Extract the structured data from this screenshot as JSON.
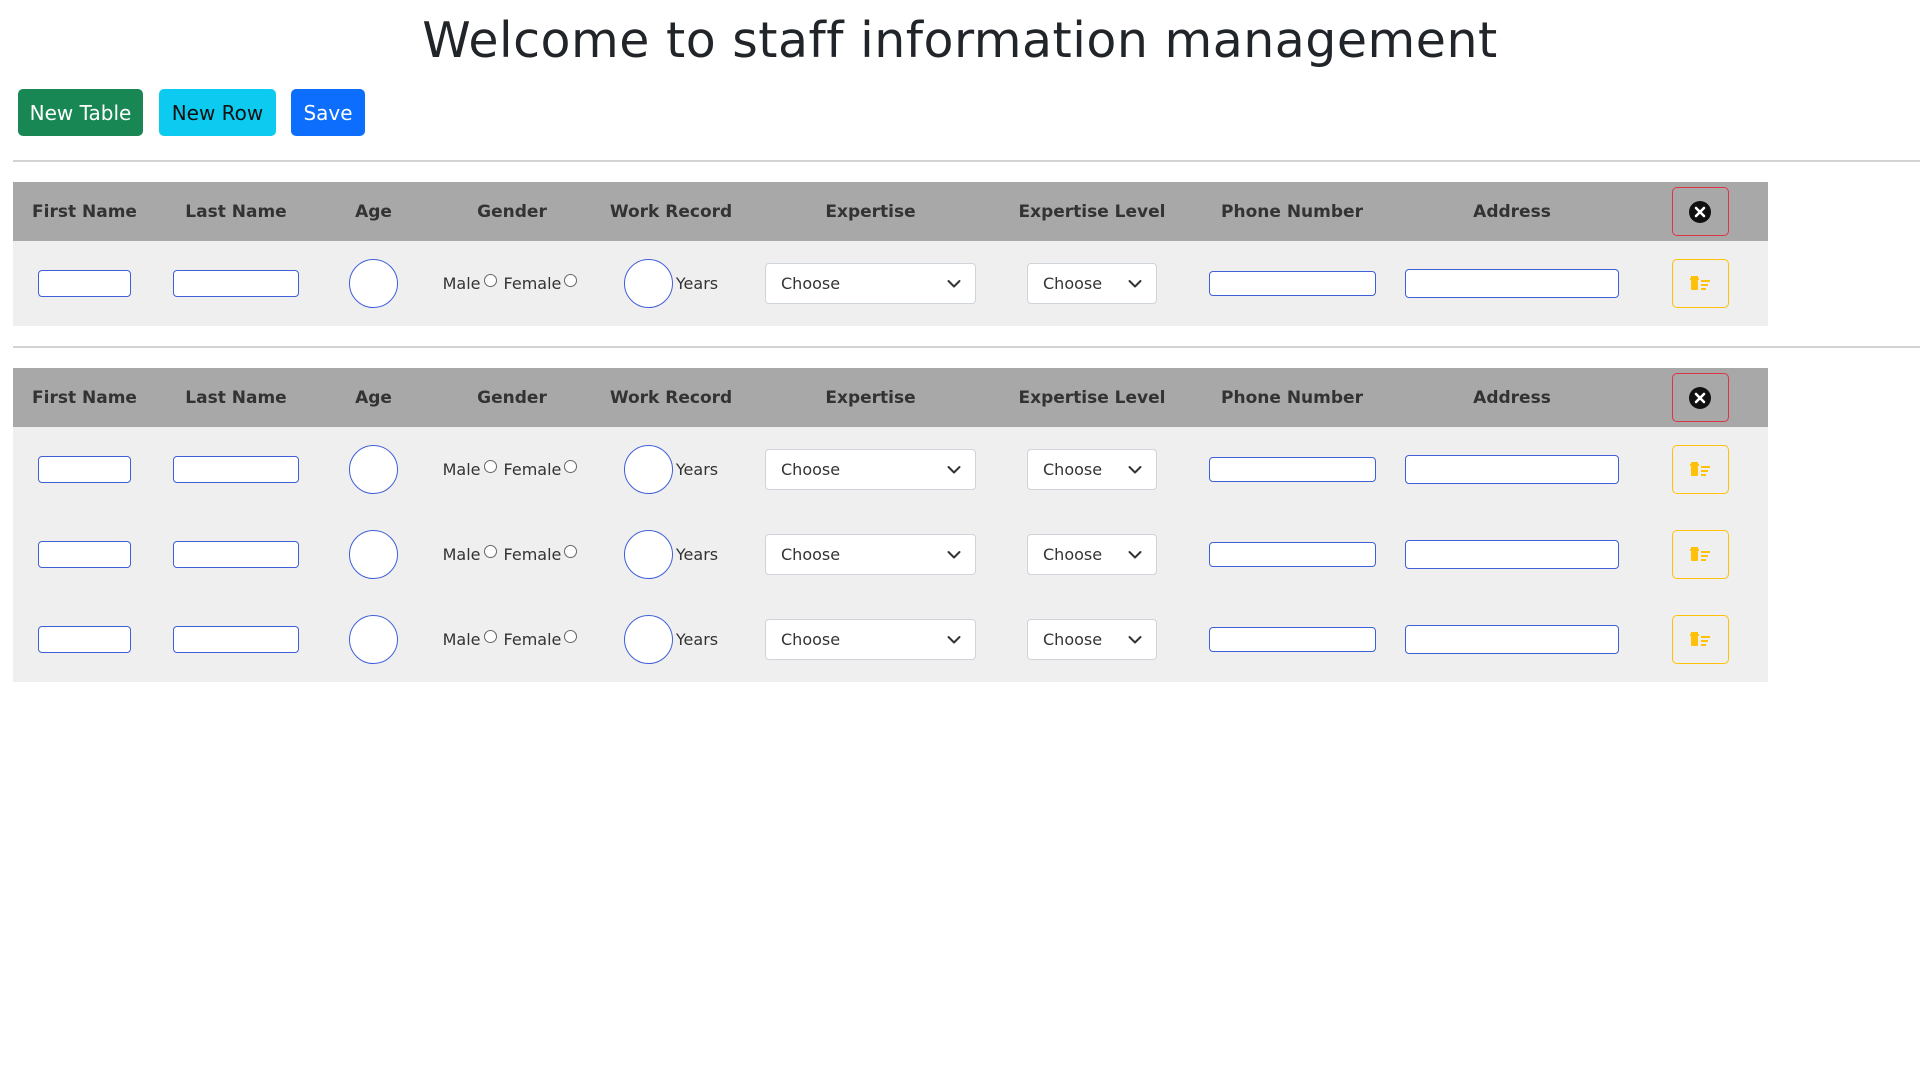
{
  "page": {
    "title": "Welcome to staff information management"
  },
  "toolbar": {
    "new_table_label": "New Table",
    "new_row_label": "New Row",
    "save_label": "Save"
  },
  "colors": {
    "success": "#198754",
    "info": "#0dcaf0",
    "primary": "#0d6efd",
    "danger": "#dc3545",
    "warning": "#ffc107",
    "header_bg": "#a8a8a8",
    "row_bg": "#efefef"
  },
  "columns": [
    "First Name",
    "Last Name",
    "Age",
    "Gender",
    "Work Record",
    "Expertise",
    "Expertise Level",
    "Phone Number",
    "Address"
  ],
  "labels": {
    "male": "Male",
    "female": "Female",
    "years": "Years",
    "expertise_placeholder": "Choose",
    "level_placeholder": "Choose"
  },
  "icons": {
    "close_table": "circle-x-icon",
    "delete_row": "trash-icon",
    "select_arrow": "chevron-down-icon"
  },
  "tables": [
    {
      "rows": 1
    },
    {
      "rows": 3
    }
  ]
}
